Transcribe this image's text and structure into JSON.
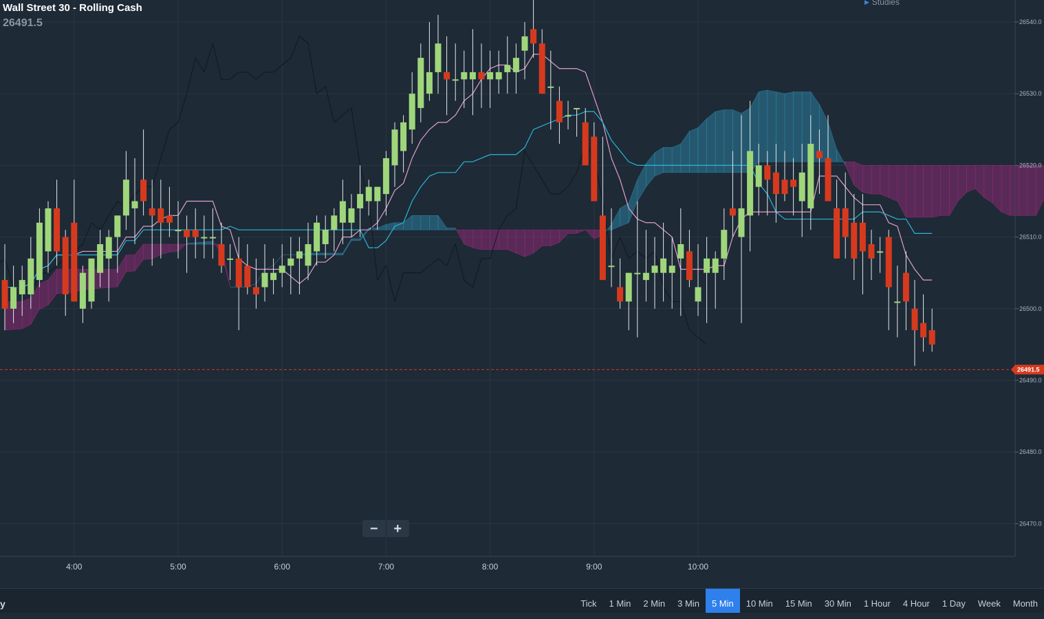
{
  "header": {
    "title": "Wall Street 30 - Rolling Cash",
    "last_price": "26491.5",
    "studies_label": "Studies"
  },
  "zoom": {
    "minus": "−",
    "plus": "+"
  },
  "bottom_bar": {
    "left_text": "y",
    "timeframes": [
      "Tick",
      "1 Min",
      "2 Min",
      "3 Min",
      "5 Min",
      "10 Min",
      "15 Min",
      "30 Min",
      "1 Hour",
      "4 Hour",
      "1 Day",
      "Week",
      "Month"
    ],
    "active": "5 Min"
  },
  "colors": {
    "background": "#1e2a36",
    "grid": "#2a3744",
    "bull": "#9fd67b",
    "bear": "#d63a1e",
    "cloud_bull": "#2b7e9e",
    "cloud_bear": "#8a2a72",
    "cloud_pink": "#9a7a94",
    "line_pink": "#e0a0d0",
    "line_cyan": "#29b8d8",
    "current_price": "#d63a1e",
    "active_tab": "#2f80ed"
  },
  "chart_data": {
    "type": "candlestick",
    "instrument": "Wall Street 30 - Rolling Cash",
    "interval": "5 Min",
    "ylim": [
      26463,
      26544
    ],
    "y_ticks": [
      26470,
      26480,
      26490,
      26500,
      26510,
      26520,
      26530,
      26540
    ],
    "x_ticks": [
      "4:00",
      "5:00",
      "6:00",
      "7:00",
      "8:00",
      "9:00",
      "10:00"
    ],
    "current_price": 26491.5,
    "start_time": "3:20",
    "candles": [
      [
        26504,
        26509,
        26497,
        26500
      ],
      [
        26500,
        26506,
        26498,
        26503
      ],
      [
        26502,
        26506,
        26499,
        26504
      ],
      [
        26502,
        26510,
        26500,
        26507
      ],
      [
        26504,
        26514,
        26503,
        26512
      ],
      [
        26508,
        26515,
        26505,
        26514
      ],
      [
        26514,
        26518,
        26506,
        26508
      ],
      [
        26510,
        26511,
        26499,
        26502
      ],
      [
        26512,
        26518,
        26506,
        26501
      ],
      [
        26500,
        26506,
        26498,
        26505
      ],
      [
        26501,
        26507,
        26500,
        26507
      ],
      [
        26505,
        26511,
        26503,
        26509
      ],
      [
        26507,
        26511,
        26501,
        26510
      ],
      [
        26510,
        26512,
        26505,
        26513
      ],
      [
        26513,
        26522,
        26511,
        26518
      ],
      [
        26514,
        26521,
        26509,
        26515
      ],
      [
        26518,
        26525,
        26513,
        26515
      ],
      [
        26514,
        26518,
        26506,
        26513
      ],
      [
        26514,
        26518,
        26507,
        26512
      ],
      [
        26513,
        26517,
        26510,
        26512
      ],
      [
        26511,
        26515,
        26507,
        26511
      ],
      [
        26511,
        26513,
        26505,
        26510
      ],
      [
        26511,
        26514,
        26507,
        26510
      ],
      [
        26510,
        26513,
        26507,
        26510
      ],
      [
        26510,
        26514,
        26507,
        26510
      ],
      [
        26509,
        26512,
        26505,
        26506
      ],
      [
        26507,
        26509,
        26504,
        26507
      ],
      [
        26507,
        26510,
        26497,
        26503
      ],
      [
        26506,
        26509,
        26502,
        26503
      ],
      [
        26503,
        26507,
        26500,
        26502
      ],
      [
        26503,
        26509,
        26501,
        26505
      ],
      [
        26504,
        26507,
        26502,
        26505
      ],
      [
        26505,
        26509,
        26503,
        26506
      ],
      [
        26506,
        26510,
        26502,
        26507
      ],
      [
        26507,
        26510,
        26502,
        26508
      ],
      [
        26506,
        26512,
        26504,
        26509
      ],
      [
        26508,
        26513,
        26506,
        26512
      ],
      [
        26509,
        26513,
        26507,
        26511
      ],
      [
        26511,
        26514,
        26508,
        26513
      ],
      [
        26512,
        26518,
        26509,
        26515
      ],
      [
        26512,
        26516,
        26510,
        26514
      ],
      [
        26514,
        26520,
        26510,
        26516
      ],
      [
        26515,
        26518,
        26513,
        26517
      ],
      [
        26515,
        26517,
        26511,
        26517
      ],
      [
        26516,
        26522,
        26513,
        26521
      ],
      [
        26520,
        26526,
        26517,
        26525
      ],
      [
        26522,
        26527,
        26519,
        26526
      ],
      [
        26525,
        26533,
        26523,
        26530
      ],
      [
        26528,
        26537,
        26526,
        26535
      ],
      [
        26530,
        26540,
        26529,
        26533
      ],
      [
        26533,
        26541,
        26530,
        26537
      ],
      [
        26533,
        26538,
        26527,
        26532
      ],
      [
        26532,
        26537,
        26529,
        26532
      ],
      [
        26532,
        26536,
        26528,
        26533
      ],
      [
        26532,
        26539,
        26527,
        26533
      ],
      [
        26533,
        26537,
        26528,
        26532
      ],
      [
        26532,
        26536,
        26528,
        26533
      ],
      [
        26532,
        26536,
        26530,
        26533
      ],
      [
        26533,
        26538,
        26530,
        26534
      ],
      [
        26533,
        26537,
        26530,
        26535
      ],
      [
        26536,
        26540,
        26532,
        26538
      ],
      [
        26539,
        26544,
        26535,
        26537
      ],
      [
        26537,
        26539,
        26530,
        26530
      ],
      [
        26531,
        26536,
        26525,
        26531
      ],
      [
        26529,
        26531,
        26523,
        26526
      ],
      [
        26527,
        26529,
        26525,
        26527
      ],
      [
        26528,
        26528,
        26524,
        26528
      ],
      [
        26526,
        26528,
        26522,
        26520
      ],
      [
        26524,
        26526,
        26515,
        26515
      ],
      [
        26513,
        26524,
        26508,
        26504
      ],
      [
        26506,
        26514,
        26503,
        26506
      ],
      [
        26503,
        26507,
        26500,
        26501
      ],
      [
        26501,
        26505,
        26497,
        26505
      ],
      [
        26505,
        26515,
        26496,
        26505
      ],
      [
        26504,
        26511,
        26501,
        26505
      ],
      [
        26505,
        26510,
        26500,
        26506
      ],
      [
        26505,
        26512,
        26501,
        26507
      ],
      [
        26505,
        26510,
        26500,
        26506
      ],
      [
        26507,
        26514,
        26499,
        26509
      ],
      [
        26508,
        26511,
        26503,
        26504
      ],
      [
        26501,
        26509,
        26499,
        26503
      ],
      [
        26505,
        26510,
        26498,
        26507
      ],
      [
        26505,
        26508,
        26500,
        26507
      ],
      [
        26507,
        26514,
        26504,
        26511
      ],
      [
        26514,
        26522,
        26510,
        26513
      ],
      [
        26510,
        26527,
        26498,
        26514
      ],
      [
        26513,
        26529,
        26508,
        26522
      ],
      [
        26517,
        26523,
        26513,
        26520
      ],
      [
        26520,
        26522,
        26513,
        26518
      ],
      [
        26519,
        26523,
        26512,
        26516
      ],
      [
        26518,
        26522,
        26515,
        26516
      ],
      [
        26518,
        26521,
        26513,
        26517
      ],
      [
        26515,
        26523,
        26510,
        26519
      ],
      [
        26514,
        26527,
        26511,
        26523
      ],
      [
        26522,
        26525,
        26516,
        26521
      ],
      [
        26521,
        26527,
        26516,
        26515
      ],
      [
        26514,
        26518,
        26510,
        26507
      ],
      [
        26514,
        26519,
        26507,
        26510
      ],
      [
        26512,
        26516,
        26504,
        26507
      ],
      [
        26512,
        26516,
        26502,
        26508
      ],
      [
        26509,
        26511,
        26504,
        26507
      ],
      [
        26508,
        26510,
        26505,
        26508
      ],
      [
        26510,
        26511,
        26497,
        26503
      ],
      [
        26501,
        26506,
        26496,
        26501
      ],
      [
        26505,
        26508,
        26497,
        26501
      ],
      [
        26500,
        26504,
        26492,
        26497
      ],
      [
        26498,
        26502,
        26494,
        26496
      ],
      [
        26497,
        26500,
        26494,
        26495
      ]
    ],
    "ichimoku": {
      "tenkan_sen": "pink line",
      "kijun_sen": "cyan line",
      "cloud": "senkou span A/B shaded areas",
      "chikou": "thin dark lagging line"
    }
  }
}
